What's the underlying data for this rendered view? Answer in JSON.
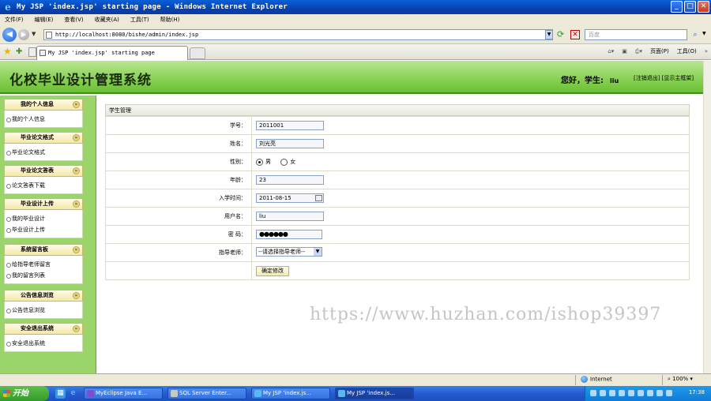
{
  "window": {
    "title": "My JSP 'index.jsp' starting page - Windows Internet Explorer",
    "min": "_",
    "max": "□",
    "close": "✕"
  },
  "menu": [
    "文件(F)",
    "编辑(E)",
    "查看(V)",
    "收藏夹(A)",
    "工具(T)",
    "帮助(H)"
  ],
  "address": {
    "url": "http://localhost:8080/bishe/admin/index.jsp",
    "search_placeholder": "百度"
  },
  "tab": {
    "label": "My JSP 'index.jsp' starting page"
  },
  "commands": {
    "page": "页面(P)",
    "tools": "工具(O)"
  },
  "header": {
    "site_title": "化校毕业设计管理系统",
    "greeting": "您好，学生:",
    "user": "liu",
    "links": "[注销退出] [显示主框架]"
  },
  "sidebar": [
    {
      "title": "我的个人信息",
      "items": [
        "我的个人信息"
      ]
    },
    {
      "title": "毕业论文格式",
      "items": [
        "毕业论文格式"
      ]
    },
    {
      "title": "毕业论文答表",
      "items": [
        "论文答表下载"
      ]
    },
    {
      "title": "毕业设计上传",
      "items": [
        "我的毕业设计",
        "毕业设计上传"
      ]
    },
    {
      "title": "系统留言板",
      "items": [
        "给指导老师留言",
        "我的留言列表"
      ]
    },
    {
      "title": "公告信息浏览",
      "items": [
        "公告信息浏览"
      ]
    },
    {
      "title": "安全退出系统",
      "items": [
        "安全退出系统"
      ]
    }
  ],
  "form": {
    "panel_title": "学生管理",
    "fields": {
      "student_no": {
        "label": "学号：",
        "value": "2011001"
      },
      "name": {
        "label": "姓名：",
        "value": "刘光亮"
      },
      "gender": {
        "label": "性别：",
        "male": "男",
        "female": "女",
        "selected": "男"
      },
      "age": {
        "label": "年龄：",
        "value": "23"
      },
      "enroll_date": {
        "label": "入学时间：",
        "value": "2011-08-15"
      },
      "username": {
        "label": "用户名：",
        "value": "liu"
      },
      "password": {
        "label": "密 码：",
        "value": "●●●●●●"
      },
      "advisor": {
        "label": "指导老师：",
        "value": "--请选择指导老师--"
      }
    },
    "submit_label": "确定修改"
  },
  "watermark": "https://www.huzhan.com/ishop39397",
  "status": {
    "zone": "Internet",
    "zoom": "100%"
  },
  "taskbar": {
    "start": "开始",
    "tasks": [
      "MyEclipse Java E...",
      "SQL Server Enter...",
      "My JSP 'index.js...",
      "My JSP 'index.js..."
    ],
    "clock": "17:38"
  }
}
